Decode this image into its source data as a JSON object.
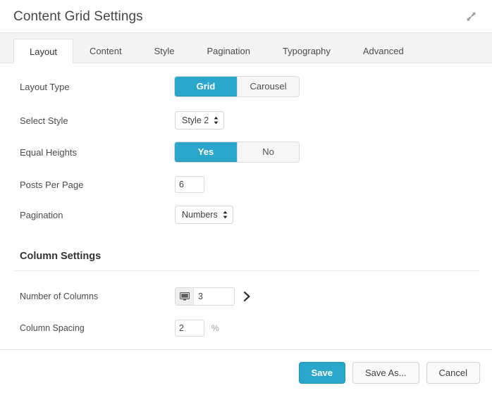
{
  "header": {
    "title": "Content Grid Settings",
    "expand_icon": "expand-diagonal-icon"
  },
  "tabs": [
    {
      "label": "Layout",
      "active": true
    },
    {
      "label": "Content",
      "active": false
    },
    {
      "label": "Style",
      "active": false
    },
    {
      "label": "Pagination",
      "active": false
    },
    {
      "label": "Typography",
      "active": false
    },
    {
      "label": "Advanced",
      "active": false
    }
  ],
  "layout_tab": {
    "rows": {
      "layout_type": {
        "label": "Layout Type",
        "options": [
          "Grid",
          "Carousel"
        ],
        "selected": "Grid"
      },
      "select_style": {
        "label": "Select Style",
        "value": "Style 2"
      },
      "equal_heights": {
        "label": "Equal Heights",
        "options": [
          "Yes",
          "No"
        ],
        "selected": "Yes"
      },
      "posts_per_page": {
        "label": "Posts Per Page",
        "value": "6"
      },
      "pagination": {
        "label": "Pagination",
        "value": "Numbers"
      }
    },
    "column_settings": {
      "title": "Column Settings",
      "number_of_columns": {
        "label": "Number of Columns",
        "value": "3",
        "device_icon": "desktop-monitor-icon",
        "next_icon": "chevron-right-icon"
      },
      "column_spacing": {
        "label": "Column Spacing",
        "value": "2",
        "unit": "%"
      }
    }
  },
  "footer": {
    "save_label": "Save",
    "save_as_label": "Save As...",
    "cancel_label": "Cancel"
  },
  "colors": {
    "accent": "#2ba6cb",
    "tabbar_bg": "#f4f4f4",
    "border": "#e3e3e3",
    "toggle_off_bg": "#f6f6f6"
  }
}
